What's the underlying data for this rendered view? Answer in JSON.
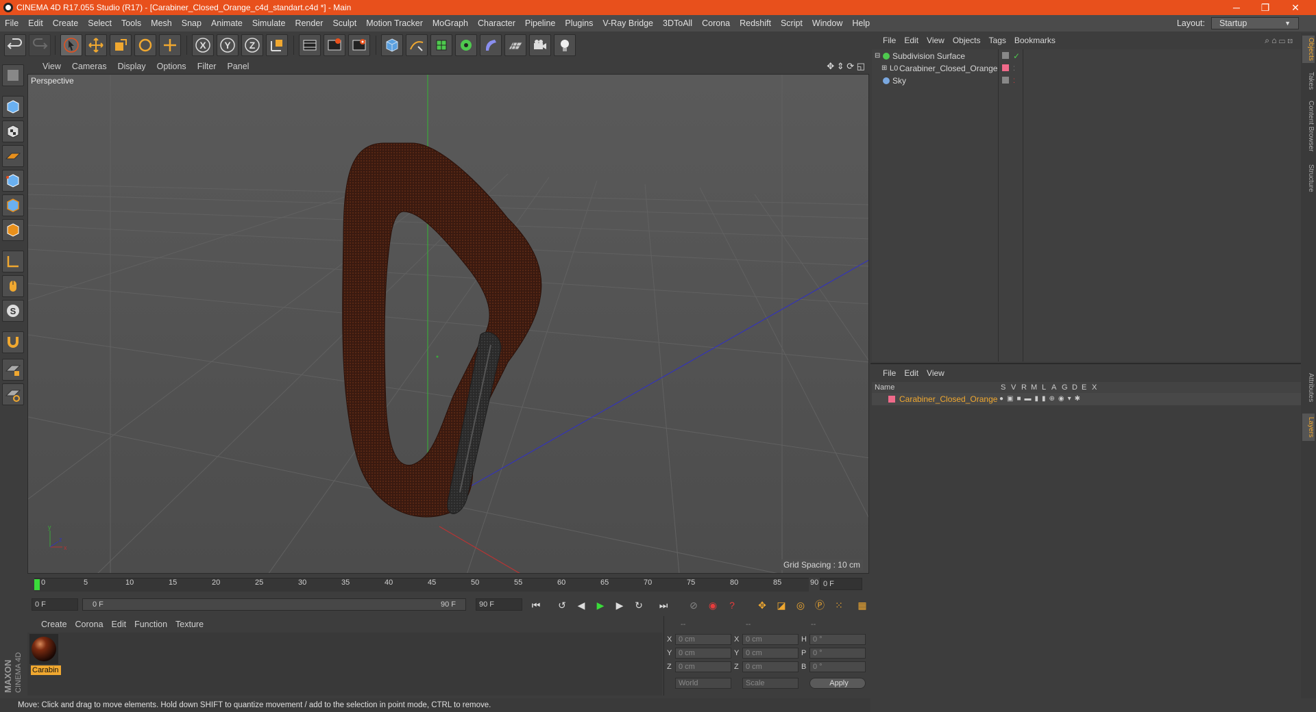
{
  "window": {
    "title": "CINEMA 4D R17.055 Studio (R17) - [Carabiner_Closed_Orange_c4d_standart.c4d *] - Main",
    "minimize": "─",
    "restore": "❐",
    "close": "✕"
  },
  "menubar": {
    "items": [
      "File",
      "Edit",
      "Create",
      "Select",
      "Tools",
      "Mesh",
      "Snap",
      "Animate",
      "Simulate",
      "Render",
      "Sculpt",
      "Motion Tracker",
      "MoGraph",
      "Character",
      "Pipeline",
      "Plugins",
      "V-Ray Bridge",
      "3DToAll",
      "Corona",
      "Redshift",
      "Script",
      "Window",
      "Help"
    ],
    "layout_label": "Layout:",
    "layout_value": "Startup"
  },
  "toolbar": {
    "icons": [
      "undo-icon",
      "redo-icon",
      "select-arrow-icon",
      "move-icon",
      "scale-icon",
      "rotate-icon",
      "live-select-icon",
      "x-axis-icon",
      "y-axis-icon",
      "z-axis-icon",
      "world-coord-icon",
      "render-view-icon",
      "render-picture-viewer-icon",
      "render-settings-icon",
      "cube-icon",
      "pen-spline-icon",
      "subdivision-icon",
      "array-icon",
      "deformer-icon",
      "floor-icon",
      "camera-icon",
      "light-icon"
    ]
  },
  "viewport": {
    "menu": [
      "View",
      "Cameras",
      "Display",
      "Options",
      "Filter",
      "Panel"
    ],
    "label": "Perspective",
    "grid_spacing": "Grid Spacing : 10 cm"
  },
  "timeline": {
    "ticks": [
      "0",
      "5",
      "10",
      "15",
      "20",
      "25",
      "30",
      "35",
      "40",
      "45",
      "50",
      "55",
      "60",
      "65",
      "70",
      "75",
      "80",
      "85",
      "90"
    ],
    "current_frame": "0 F",
    "start_field": "0 F",
    "range_start": "0 F",
    "range_end": "90 F",
    "end_field": "90 F"
  },
  "material_manager": {
    "menu": [
      "Create",
      "Corona",
      "Edit",
      "Function",
      "Texture"
    ],
    "material_name": "Carabin"
  },
  "coordinates": {
    "header": [
      "--",
      "--",
      "--"
    ],
    "rows": [
      {
        "l1": "X",
        "v1": "0 cm",
        "l2": "X",
        "v2": "0 cm",
        "l3": "H",
        "v3": "0 °"
      },
      {
        "l1": "Y",
        "v1": "0 cm",
        "l2": "Y",
        "v2": "0 cm",
        "l3": "P",
        "v3": "0 °"
      },
      {
        "l1": "Z",
        "v1": "0 cm",
        "l2": "Z",
        "v2": "0 cm",
        "l3": "B",
        "v3": "0 °"
      }
    ],
    "mode_world": "World",
    "mode_scale": "Scale",
    "apply": "Apply"
  },
  "status": {
    "text": "Move: Click and drag to move elements. Hold down SHIFT to quantize movement / add to the selection in point mode, CTRL to remove."
  },
  "object_manager": {
    "menu": [
      "File",
      "Edit",
      "View",
      "Objects",
      "Tags",
      "Bookmarks"
    ],
    "objects": [
      {
        "name": "Subdivision Surface",
        "color": "#4ec94e"
      },
      {
        "name": "Carabiner_Closed_Orange",
        "color": "#cfcfcf"
      },
      {
        "name": "Sky",
        "color": "#7aa8e0"
      }
    ]
  },
  "layer_manager": {
    "menu": [
      "File",
      "Edit",
      "View"
    ],
    "columns": [
      "Name",
      "S",
      "V",
      "R",
      "M",
      "L",
      "A",
      "G",
      "D",
      "E",
      "X"
    ],
    "layer_name": "Carabiner_Closed_Orange",
    "layer_color": "#f06a8a"
  },
  "side_tabs": [
    "Objects",
    "Takes",
    "Content Browser",
    "Structure",
    "Attributes",
    "Layers"
  ],
  "brand": {
    "maxon": "MAXON",
    "cinema": "CINEMA 4D"
  },
  "colors": {
    "accent": "#e8501c",
    "selected_text": "#f0a830"
  }
}
